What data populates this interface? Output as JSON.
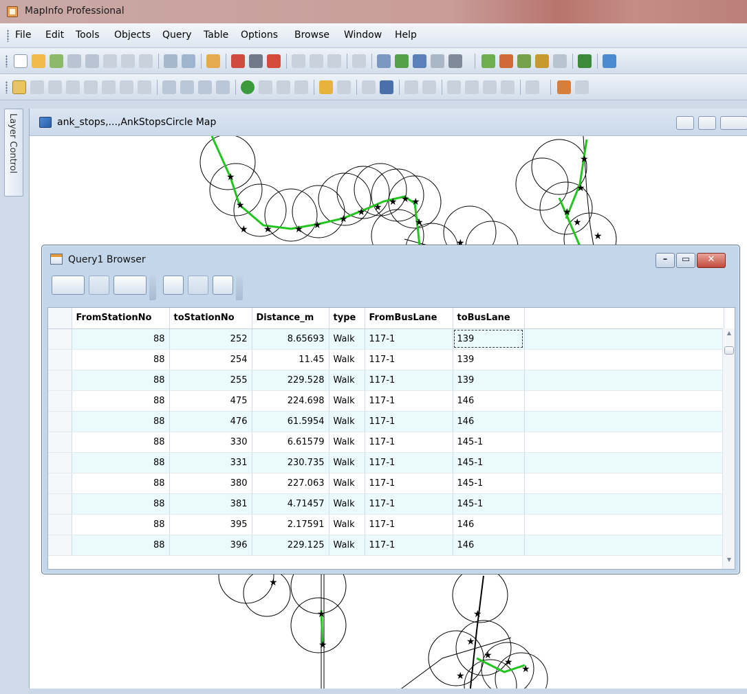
{
  "app": {
    "title": "MapInfo Professional"
  },
  "menu": [
    "File",
    "Edit",
    "Tools",
    "Objects",
    "Query",
    "Table",
    "Options",
    "Browse",
    "Window",
    "Help"
  ],
  "layer_control": {
    "label": "Layer Control"
  },
  "map_window": {
    "title": "ank_stops,...,AnkStopsCircle Map"
  },
  "browser": {
    "title": "Query1 Browser",
    "columns": [
      "FromStationNo",
      "toStationNo",
      "Distance_m",
      "type",
      "FromBusLane",
      "toBusLane"
    ],
    "rows": [
      [
        "88",
        "252",
        "8.65693",
        "Walk",
        "117-1",
        "139"
      ],
      [
        "88",
        "254",
        "11.45",
        "Walk",
        "117-1",
        "139"
      ],
      [
        "88",
        "255",
        "229.528",
        "Walk",
        "117-1",
        "139"
      ],
      [
        "88",
        "475",
        "224.698",
        "Walk",
        "117-1",
        "146"
      ],
      [
        "88",
        "476",
        "61.5954",
        "Walk",
        "117-1",
        "146"
      ],
      [
        "88",
        "330",
        "6.61579",
        "Walk",
        "117-1",
        "145-1"
      ],
      [
        "88",
        "331",
        "230.735",
        "Walk",
        "117-1",
        "145-1"
      ],
      [
        "88",
        "380",
        "227.063",
        "Walk",
        "117-1",
        "145-1"
      ],
      [
        "88",
        "381",
        "4.71457",
        "Walk",
        "117-1",
        "145-1"
      ],
      [
        "88",
        "395",
        "2.17591",
        "Walk",
        "117-1",
        "146"
      ],
      [
        "88",
        "396",
        "229.125",
        "Walk",
        "117-1",
        "146"
      ]
    ]
  },
  "colors": {
    "route_green": "#22c41e",
    "row_alt": "#eafafd",
    "title_bar": "#c99d99"
  }
}
